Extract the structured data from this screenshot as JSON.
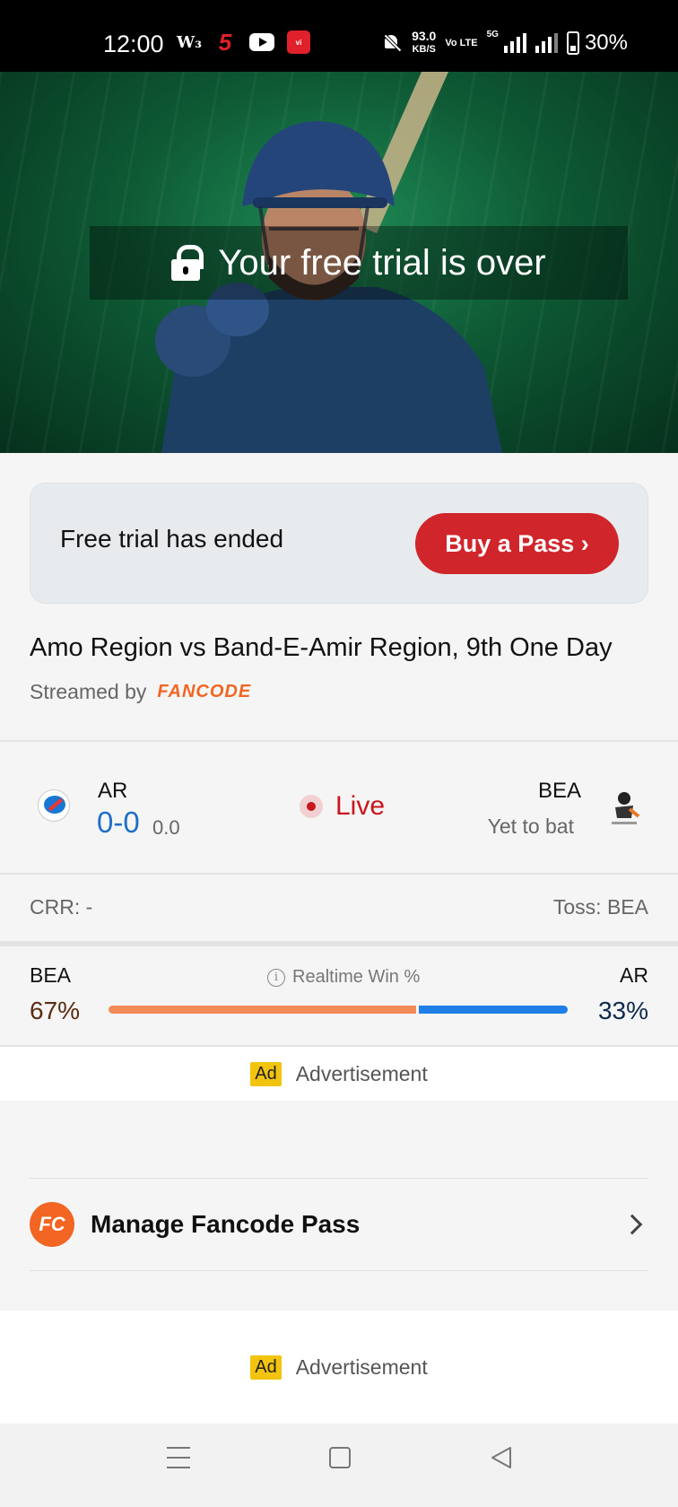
{
  "status_bar": {
    "time": "12:00",
    "icons_left": [
      "W-icon",
      "channel5-icon",
      "youtube-icon",
      "vi-app-icon"
    ],
    "speed_value": "93.0",
    "speed_unit": "KB/S",
    "volte": "Vo LTE",
    "network": "5G",
    "battery": "30%"
  },
  "hero": {
    "lock_icon": "lock-icon",
    "message": "Your free trial is over"
  },
  "trial_card": {
    "message": "Free trial has ended",
    "button": "Buy a Pass ›"
  },
  "match": {
    "title": "Amo Region vs Band-E-Amir Region, 9th One Day",
    "streamed_by": "Streamed by",
    "provider": "FANCODE"
  },
  "scoreboard": {
    "team1": {
      "short": "AR",
      "score": "0-0",
      "overs": "0.0"
    },
    "status": "Live",
    "team2": {
      "short": "BEA",
      "status": "Yet to bat"
    },
    "crr": "CRR: -",
    "toss": "Toss: BEA"
  },
  "win_probability": {
    "label": "Realtime Win %",
    "left_team": "BEA",
    "left_pct": "67%",
    "left_value": 67,
    "right_team": "AR",
    "right_pct": "33%",
    "right_value": 33,
    "colors": {
      "left": "#f28b57",
      "right": "#1f7fe6"
    }
  },
  "ads": [
    {
      "badge": "Ad",
      "text": "Advertisement"
    },
    {
      "badge": "Ad",
      "text": "Advertisement"
    }
  ],
  "manage_pass": {
    "icon_text": "FC",
    "label": "Manage Fancode Pass"
  },
  "colors": {
    "brand_red": "#d0252b",
    "fancode_orange": "#f26522",
    "live_red": "#c8161d",
    "score_blue": "#1e6fc8"
  }
}
